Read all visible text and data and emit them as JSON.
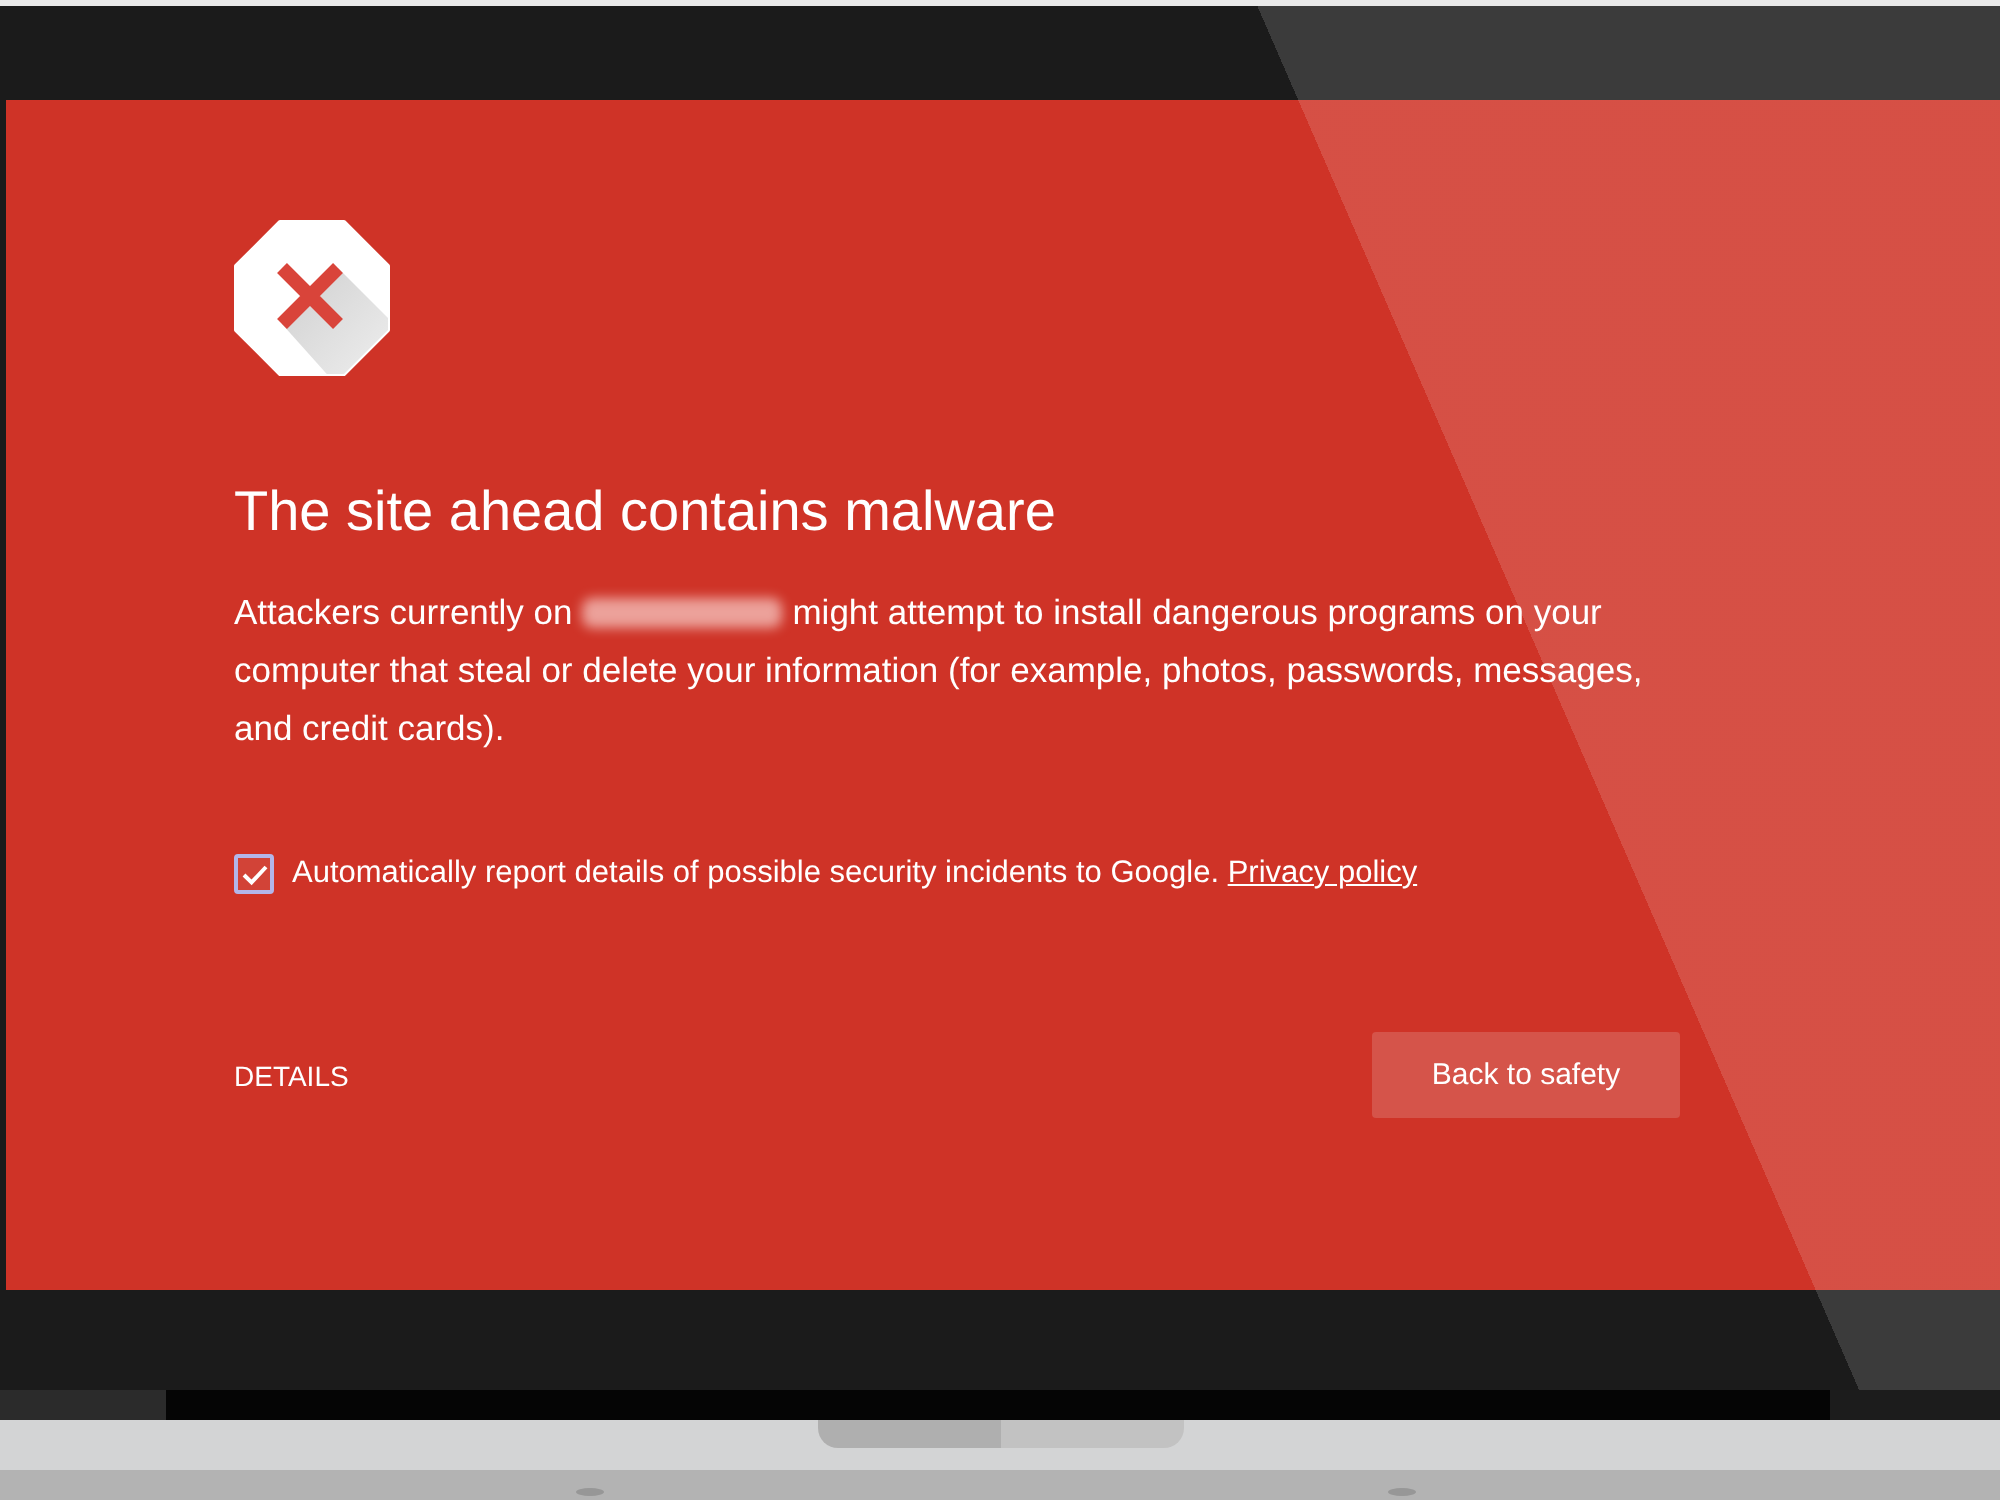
{
  "warning": {
    "title": "The site ahead contains malware",
    "description_before": "Attackers currently on",
    "redacted_site": true,
    "description_after": "might attempt to install dangerous programs on your computer that steal or delete your information (for example, photos, passwords, messages, and credit cards)."
  },
  "report_option": {
    "checked": true,
    "label": "Automatically report details of possible security incidents to Google.",
    "link": "Privacy policy"
  },
  "actions": {
    "details_link": "DETAILS",
    "primary_button": "Back to safety"
  }
}
